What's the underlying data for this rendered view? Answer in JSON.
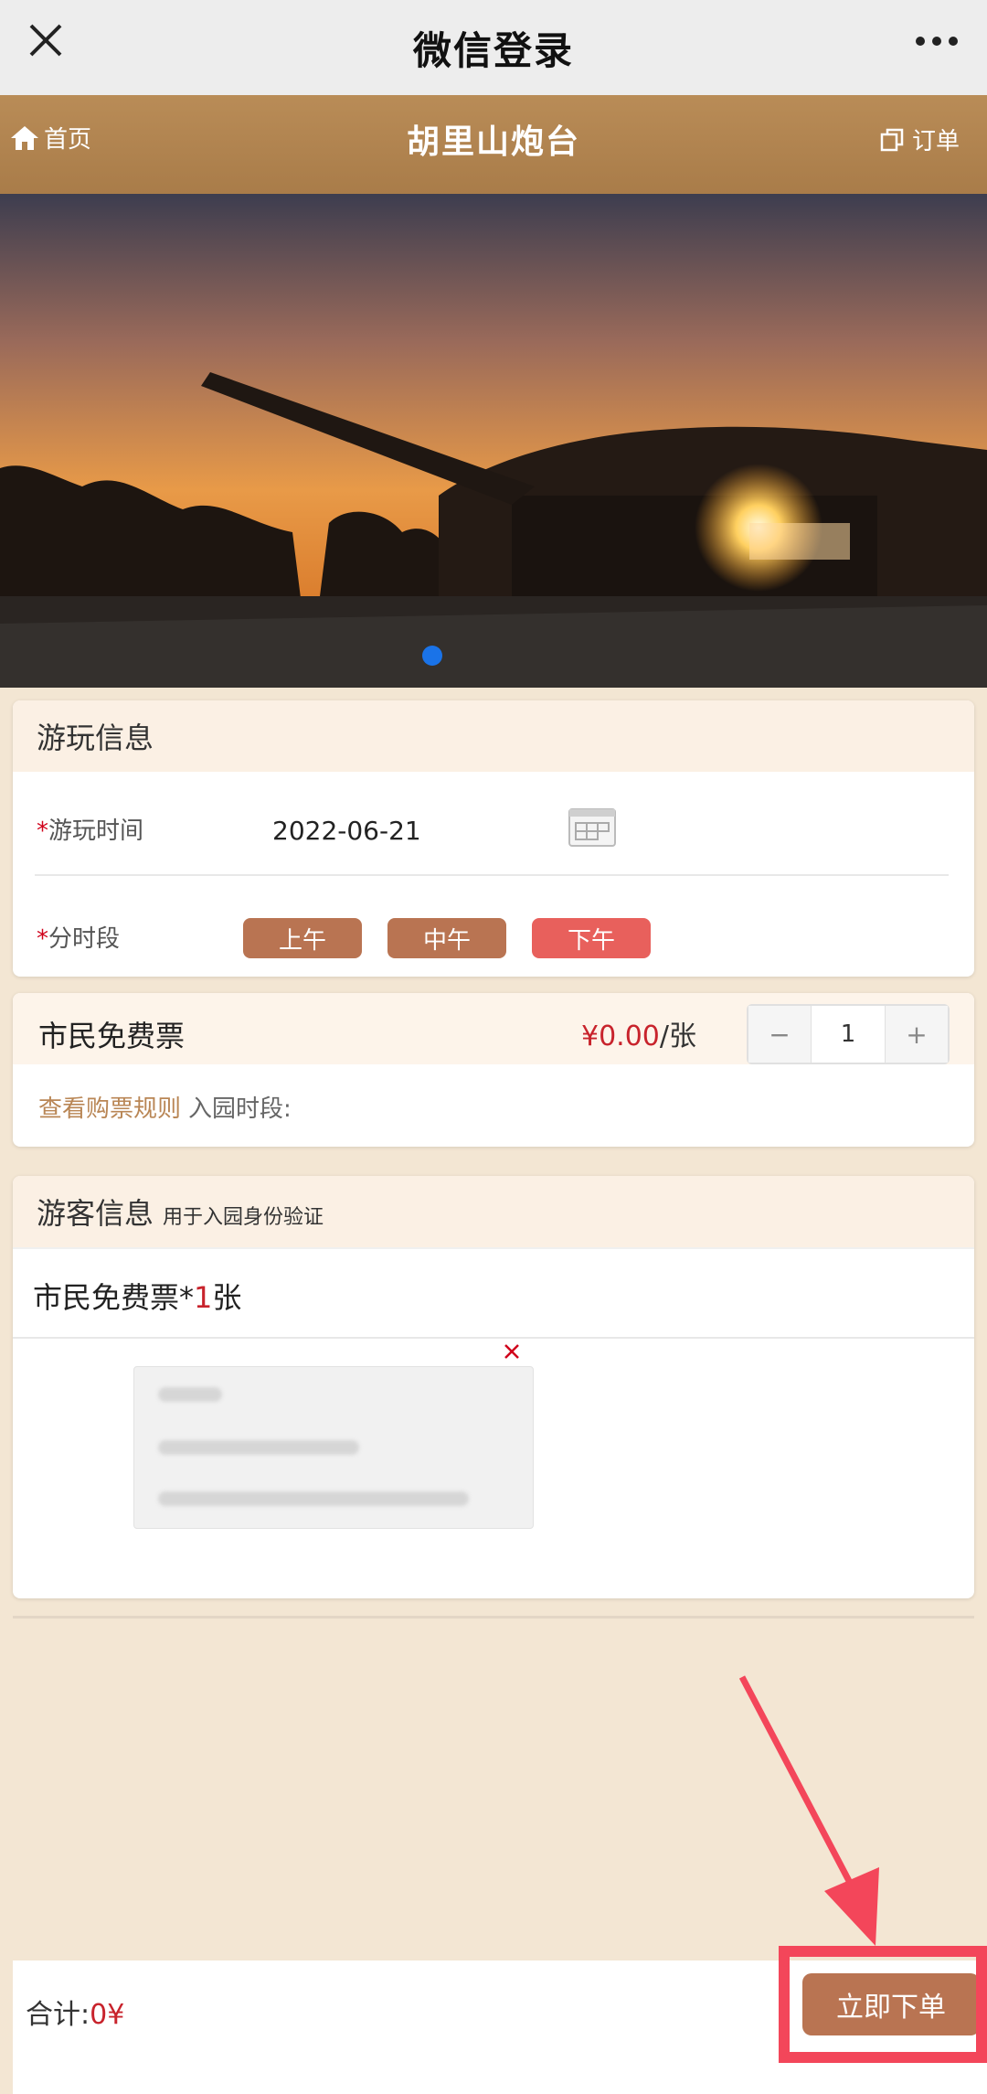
{
  "wechat": {
    "title": "微信登录",
    "close_icon": "close-icon",
    "more_icon": "more-icon"
  },
  "header": {
    "home_label": "首页",
    "title": "胡里山炮台",
    "order_label": "订单"
  },
  "banner": {
    "slide_count": 1,
    "active_slide": 1
  },
  "visit_info": {
    "title": "游玩信息",
    "date_label": "游玩时间",
    "date_value": "2022-06-21",
    "slot_label": "分时段",
    "slots": [
      "上午",
      "中午",
      "下午"
    ],
    "selected_slot": "下午",
    "required_mark": "*"
  },
  "ticket": {
    "name": "市民免费票",
    "price": "¥0.00",
    "unit": "/张",
    "minus": "−",
    "plus": "+",
    "quantity": "1",
    "rules_link": "查看购票规则",
    "enter_label": "入园时段:"
  },
  "visitor": {
    "title": "游客信息",
    "subtitle": "用于入园身份验证",
    "ticket_prefix": "市民免费票*",
    "ticket_count": "1",
    "ticket_suffix": "张",
    "remove": "×"
  },
  "footer": {
    "total_label": "合计:",
    "total_value": "0¥",
    "submit_label": "立即下单"
  },
  "colors": {
    "accent": "#b97452",
    "selected": "#e8605c",
    "price": "#c8232c",
    "highlight": "#f3465a"
  }
}
